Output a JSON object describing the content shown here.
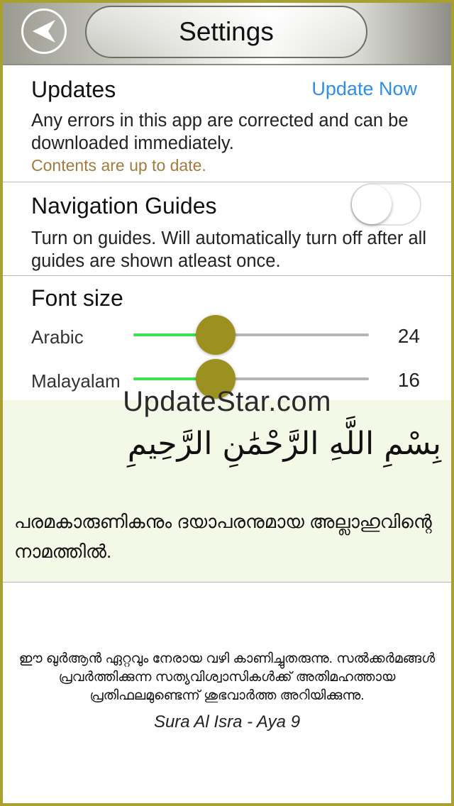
{
  "header": {
    "title": "Settings",
    "back_icon": "back-arrow-icon"
  },
  "updates": {
    "title": "Updates",
    "action_label": "Update Now",
    "description": "Any errors in this app are corrected and can be downloaded immediately.",
    "status": "Contents are up to date."
  },
  "navigation_guides": {
    "title": "Navigation Guides",
    "description": "Turn on guides. Will automatically turn off after all guides are shown atleast once.",
    "enabled": false
  },
  "font_size": {
    "title": "Font size",
    "sliders": [
      {
        "label": "Arabic",
        "value": "24",
        "level_percent": 35
      },
      {
        "label": "Malayalam",
        "value": "16",
        "level_percent": 35
      }
    ]
  },
  "preview": {
    "arabic_text": "بِسْمِ اللَّهِ الرَّحْمَٰنِ الرَّحِيمِ",
    "malayalam_text": "പരമകാരുണികനും ദയാപരനുമായ അല്ലാഹുവിന്റെ നാമത്തിൽ."
  },
  "watermark": "UpdateStar.com",
  "footer": {
    "quote": "ഈ ഖുർആൻ ഏറ്റവും നേരായ വഴി കാണിച്ചുതരുന്നു. സൽക്കർമങ്ങൾ പ്രവർത്തിക്കുന്ന സത്യവിശ്വാസികൾക്ക് അതിമഹത്തായ പ്രതിഫലമുണ്ടെന്ന് ശുഭവാർത്ത അറിയിക്കുന്നു.",
    "reference": "Sura Al Isra - Aya 9"
  },
  "colors": {
    "accent_link": "#2f8ee6",
    "status_text": "#a57a3e",
    "slider_fill": "#3ee24e",
    "slider_thumb": "#9c9020",
    "frame_border": "#a8a030",
    "preview_bg": "#f4f8e6"
  }
}
